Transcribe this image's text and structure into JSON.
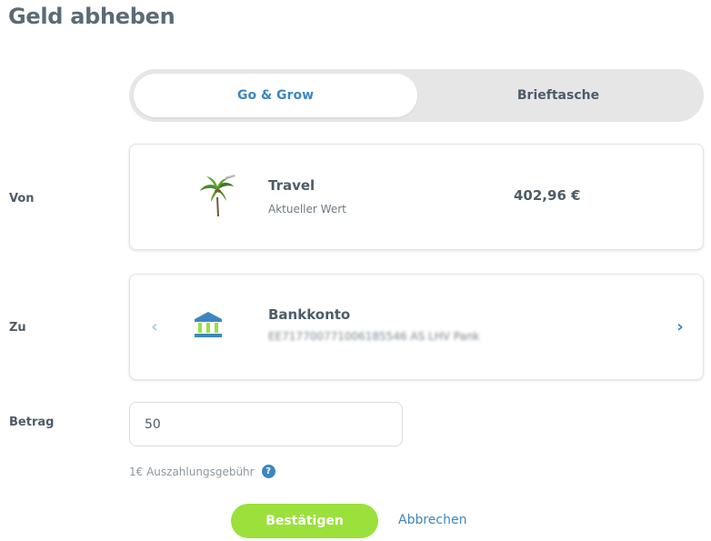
{
  "page": {
    "title": "Geld abheben"
  },
  "tabs": [
    {
      "label": "Go & Grow",
      "active": true
    },
    {
      "label": "Brieftasche",
      "active": false
    }
  ],
  "from": {
    "label": "Von",
    "goal_name": "Travel",
    "subtitle": "Aktueller Wert",
    "value": "402,96 €",
    "icon": "palm-tree-icon"
  },
  "to": {
    "label": "Zu",
    "account_name": "Bankkonto",
    "iban_blurred": "EE717700771006185546 AS LHV Pank",
    "icon": "bank-icon",
    "prev_glyph": "‹",
    "next_glyph": "›"
  },
  "amount": {
    "label": "Betrag",
    "value": "50"
  },
  "fee": {
    "text": "1€ Auszahlungsgebühr",
    "help_glyph": "?"
  },
  "actions": {
    "confirm": "Bestätigen",
    "cancel": "Abbrechen"
  },
  "colors": {
    "accent": "#3d86bf",
    "confirm": "#9be03b",
    "tab_track": "#e6e6e6"
  }
}
